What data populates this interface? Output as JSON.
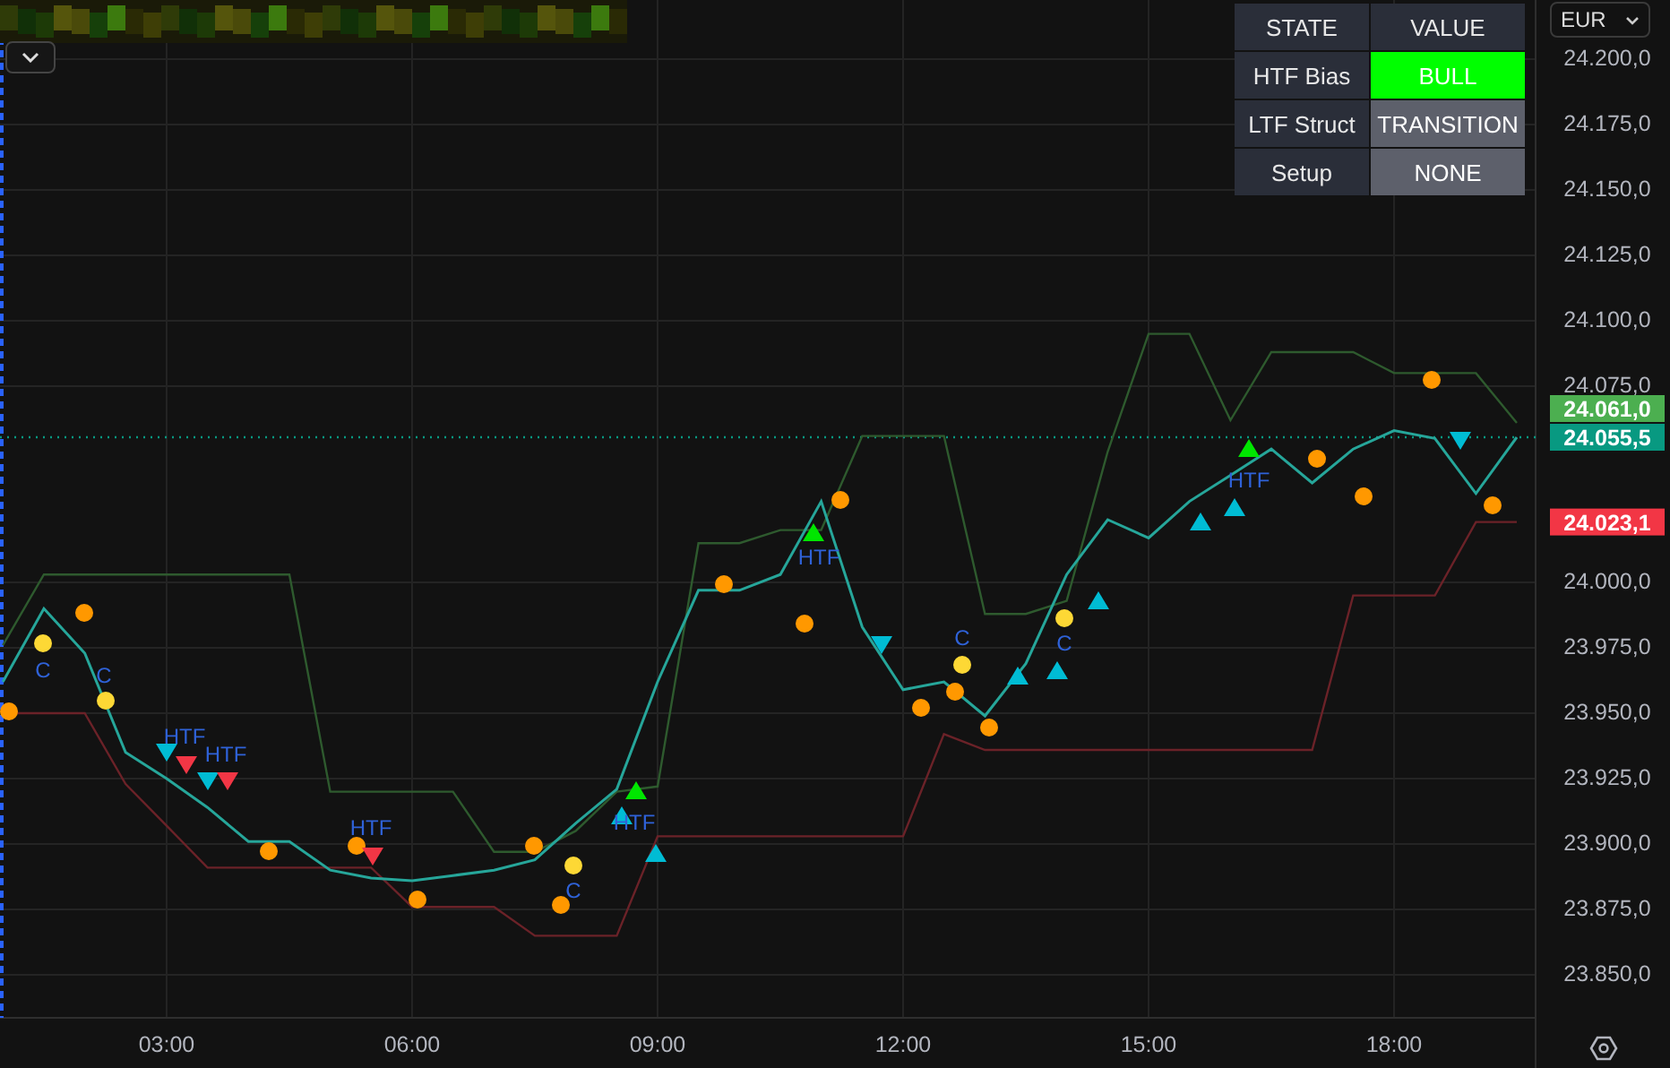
{
  "toolbar": {
    "currency": "EUR"
  },
  "state_table": {
    "columns": [
      "STATE",
      "VALUE"
    ],
    "rows": [
      {
        "state": "HTF Bias",
        "value": "BULL",
        "color": "#00ff00"
      },
      {
        "state": "LTF Struct",
        "value": "TRANSITION",
        "color": "#5d606b"
      },
      {
        "state": "Setup",
        "value": "NONE",
        "color": "#5d606b"
      }
    ]
  },
  "chart": {
    "chart_data": {
      "type": "line",
      "grid": true,
      "xlim": [
        0.964,
        19.73
      ],
      "ylim": [
        23833.6,
        24222.6
      ],
      "x": [
        1.0,
        1.5,
        2.0,
        2.5,
        3.0,
        3.5,
        4.0,
        4.5,
        5.0,
        5.5,
        6.0,
        6.5,
        7.0,
        7.5,
        8.0,
        8.5,
        9.0,
        9.5,
        10.0,
        10.5,
        11.0,
        11.5,
        12.0,
        12.5,
        13.0,
        13.5,
        14.0,
        14.5,
        15.0,
        15.5,
        16.0,
        16.5,
        17.0,
        17.5,
        18.0,
        18.5,
        19.0,
        19.5
      ],
      "series": [
        {
          "color": "#2e5a2e",
          "values": [
            23976,
            24003,
            24003,
            24003,
            24003,
            24003,
            24003,
            24003,
            23920,
            23920,
            23920,
            23920,
            23897,
            23897,
            23905,
            23920,
            23922,
            24015,
            24015,
            24020,
            24020,
            24056,
            24056,
            24056,
            23988,
            23988,
            23993,
            24050,
            24095,
            24095,
            24062,
            24088,
            24088,
            24088,
            24080,
            24080,
            24080,
            24061
          ]
        },
        {
          "color": "#6b2228",
          "values": [
            23950,
            23950,
            23950,
            23923,
            23907,
            23891,
            23891,
            23891,
            23891,
            23891,
            23876,
            23876,
            23876,
            23865,
            23865,
            23865,
            23903,
            23903,
            23903,
            23903,
            23903,
            23903,
            23903,
            23942,
            23936,
            23936,
            23936,
            23936,
            23936,
            23936,
            23936,
            23936,
            23936,
            23995,
            23995,
            23995,
            24023.1,
            24023.1
          ]
        },
        {
          "color": "#26a69a",
          "values": [
            23962,
            23990,
            23973,
            23935,
            23925,
            23914,
            23901,
            23901,
            23890,
            23887,
            23886,
            23888,
            23890,
            23894,
            23908,
            23921,
            23962,
            23997,
            23997,
            24003,
            24031,
            23983,
            23959,
            23962,
            23949,
            23969,
            24003,
            24024,
            24017,
            24031,
            24041,
            24051,
            24038,
            24051,
            24058,
            24055,
            24034,
            24055.5
          ]
        }
      ],
      "ref_lines": [
        {
          "axis": "y",
          "value": 24055.5,
          "label": "24.055,5",
          "color": "#089981"
        }
      ],
      "xticks": [
        {
          "value": 3,
          "label": "03:00"
        },
        {
          "value": 6,
          "label": "06:00"
        },
        {
          "value": 9,
          "label": "09:00"
        },
        {
          "value": 12,
          "label": "12:00"
        },
        {
          "value": 15,
          "label": "15:00"
        },
        {
          "value": 18,
          "label": "18:00"
        }
      ],
      "yticks": [
        {
          "value": 24200,
          "label": "24.200,0"
        },
        {
          "value": 24175,
          "label": "24.175,0"
        },
        {
          "value": 24150,
          "label": "24.150,0"
        },
        {
          "value": 24125,
          "label": "24.125,0"
        },
        {
          "value": 24100,
          "label": "24.100,0"
        },
        {
          "value": 24075,
          "label": "24.075,0"
        },
        {
          "value": 24000,
          "label": "24.000,0"
        },
        {
          "value": 23975,
          "label": "23.975,0"
        },
        {
          "value": 23950,
          "label": "23.950,0"
        },
        {
          "value": 23925,
          "label": "23.925,0"
        },
        {
          "value": 23900,
          "label": "23.900,0"
        },
        {
          "value": 23875,
          "label": "23.875,0"
        },
        {
          "value": 23850,
          "label": "23.850,0"
        }
      ]
    },
    "price_tags": [
      {
        "text": "24.061,0",
        "color": "#4caf50"
      },
      {
        "text": "24.023,1",
        "color": "#f23645"
      }
    ],
    "signal_labels": [
      "C",
      "C",
      "HTF",
      "HTF",
      "HTF",
      "C",
      "HTF",
      "HTF",
      "C",
      "C",
      "HTF"
    ]
  }
}
